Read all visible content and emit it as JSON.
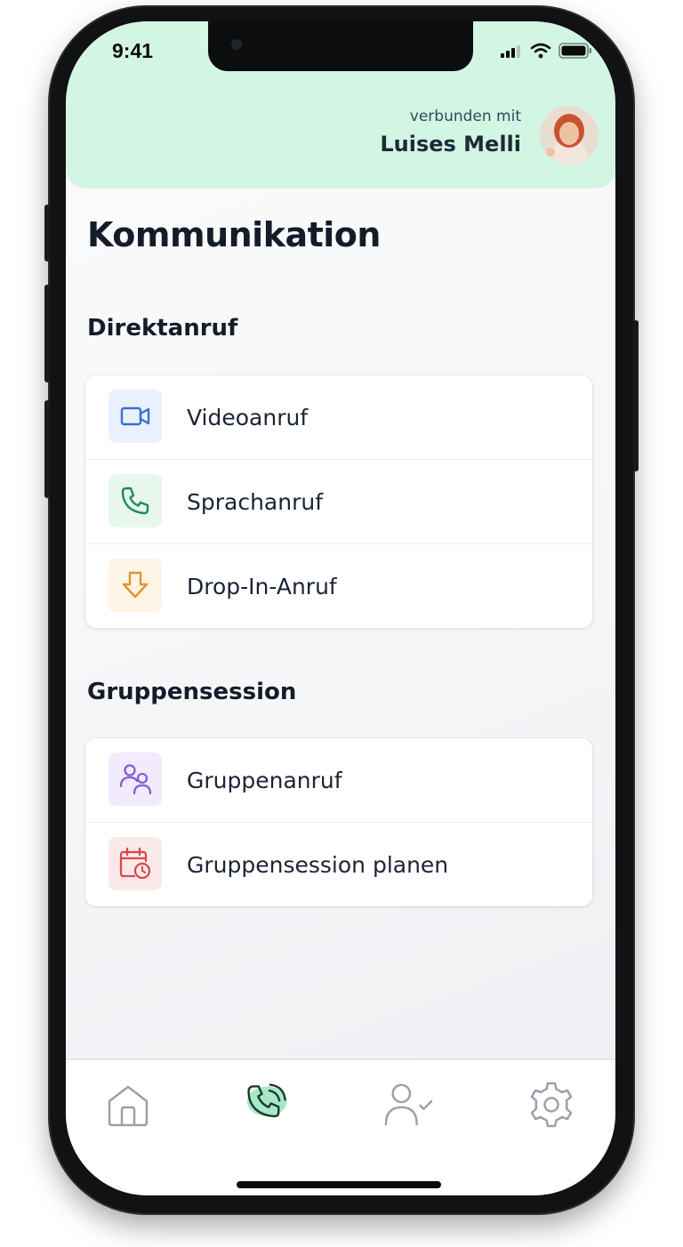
{
  "status_bar": {
    "time": "9:41"
  },
  "header": {
    "connected_label": "verbunden mit",
    "connected_name": "Luises Melli"
  },
  "page": {
    "title": "Kommunikation"
  },
  "sections": [
    {
      "title": "Direktanruf",
      "items": [
        {
          "label": "Videoanruf",
          "icon": "video-camera-icon",
          "icon_color": "#3b6fd8",
          "icon_bg": "#e9f1fd"
        },
        {
          "label": "Sprachanruf",
          "icon": "phone-icon",
          "icon_color": "#1e8a5a",
          "icon_bg": "#e7f7ee"
        },
        {
          "label": "Drop-In-Anruf",
          "icon": "arrow-down-icon",
          "icon_color": "#e0952a",
          "icon_bg": "#fef4e6"
        }
      ]
    },
    {
      "title": "Gruppensession",
      "items": [
        {
          "label": "Gruppenanruf",
          "icon": "group-users-icon",
          "icon_color": "#8a5ad8",
          "icon_bg": "#f1ebfb"
        },
        {
          "label": "Gruppensession planen",
          "icon": "calendar-clock-icon",
          "icon_color": "#d84a4a",
          "icon_bg": "#fbe9e9"
        }
      ]
    }
  ],
  "tabbar": {
    "tabs": [
      {
        "icon": "home-icon",
        "active": false
      },
      {
        "icon": "phone-call-icon",
        "active": true
      },
      {
        "icon": "user-check-icon",
        "active": false
      },
      {
        "icon": "gear-icon",
        "active": false
      }
    ],
    "active_color": "#1e3a2e",
    "inactive_color": "#9aa1ab",
    "active_blob_color": "#a8e8c8"
  }
}
